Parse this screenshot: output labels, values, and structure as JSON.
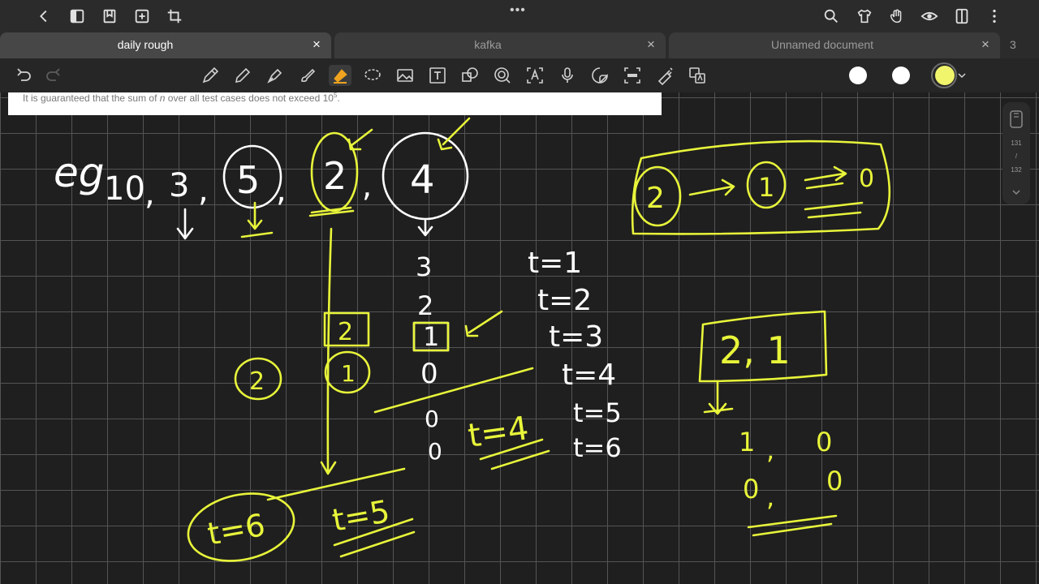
{
  "topbar": {
    "more_label": "•••",
    "icons": [
      "back-icon",
      "sidebar-icon",
      "bookmark-icon",
      "add-page-icon",
      "crop-icon",
      "search-icon",
      "shirt-icon",
      "hand-icon",
      "eye-icon",
      "book-icon",
      "more-vertical-icon"
    ]
  },
  "tabs": [
    {
      "label": "daily rough",
      "active": true
    },
    {
      "label": "kafka",
      "active": false
    },
    {
      "label": "Unnamed document",
      "active": false
    }
  ],
  "tab_close_glyph": "×",
  "tab_count": "3",
  "toolbar": {
    "tools": [
      "undo-icon",
      "redo-icon",
      "pen-icon",
      "pencil-icon",
      "fountain-pen-icon",
      "brush-icon",
      "highlighter-icon",
      "lasso-icon",
      "image-icon",
      "text-icon",
      "shape-icon",
      "zoom-icon",
      "ocr-text-icon",
      "microphone-icon",
      "sticker-icon",
      "ocr-icon",
      "laser-icon",
      "translate-icon"
    ],
    "colors": [
      "#ffffff",
      "#ffffff",
      "#f1f56b"
    ],
    "selected_tool": "highlighter-icon"
  },
  "canvas": {
    "pasted_text_a": "It is guaranteed that the sum of ",
    "pasted_text_var": "n",
    "pasted_text_b": " over all test cases does not exceed 10",
    "pasted_text_exp": "5",
    "pasted_text_end": ".",
    "ink_colors": {
      "white": "#ffffff",
      "yellow": "#e8f53a"
    },
    "handwriting": {
      "eg": "eg",
      "n10": "10",
      "comma": ",",
      "n3": "3",
      "n5": "5",
      "n2": "2",
      "n4": "4",
      "col3": "3",
      "col2": "2",
      "col1": "1",
      "col0": "0",
      "col0b": "0",
      "col0c": "0",
      "t1": "t=1",
      "t2": "t=2",
      "t3": "t=3",
      "t4": "t=4",
      "t5": "t=5",
      "t6": "t=6",
      "y2": "2",
      "y1": "1",
      "y2c": "2",
      "y_t4": "t=4",
      "y_t6": "t=6",
      "y_t5": "t=5",
      "seq_2": "2",
      "seq_1": "1",
      "seq_0": "0",
      "box_21": "2, 1",
      "r1": "1",
      "r0a": "0",
      "r0b": "0",
      "r0c": "0"
    }
  },
  "scroller": {
    "current": "131",
    "sep": "/",
    "total": "132"
  }
}
